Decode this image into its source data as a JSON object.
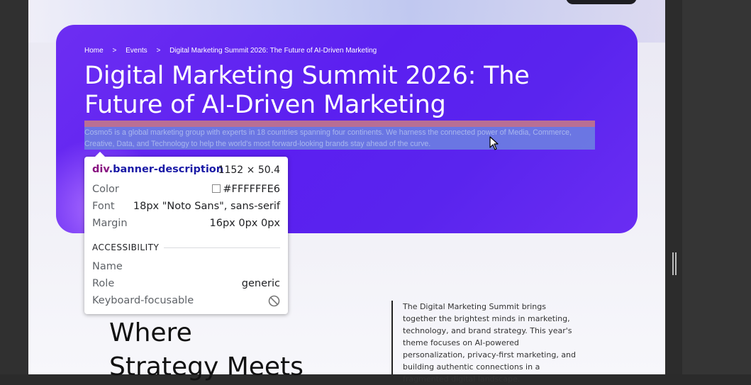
{
  "breadcrumb": {
    "home": "Home",
    "sep": ">",
    "events": "Events",
    "current": "Digital Marketing Summit 2026: The Future of AI-Driven Marketing"
  },
  "banner": {
    "title": "Digital Marketing Summit 2026: The Future of AI-Driven Marketing",
    "description": "Cosmo5 is a global marketing group with experts in 18 countries spanning four continents. We harness the connected power of Media, Commerce, Creative, Data, and Technology to help the world's most forward-looking brands stay ahead of the curve."
  },
  "inspector": {
    "tag": "div",
    "class_name": ".banner-description",
    "size": "1152 × 50.4",
    "color_label": "Color",
    "color_value": "#FFFFFFE6",
    "font_label": "Font",
    "font_value": "18px \"Noto Sans\", sans-serif",
    "margin_label": "Margin",
    "margin_value": "16px 0px 0px",
    "section_title": "ACCESSIBILITY",
    "name_label": "Name",
    "name_value": "",
    "role_label": "Role",
    "role_value": "generic",
    "focusable_label": "Keyboard-focusable"
  },
  "section": {
    "heading_line1": "Where",
    "heading_line2": "Strategy Meets",
    "intro": "The Digital Marketing Summit brings together the brightest minds in marketing, technology, and brand strategy. This year's theme focuses on AI-powered personalization, privacy-first marketing, and building authentic connections in a fragmented digital landscape."
  },
  "colors": {
    "banner": "#5b1ff0",
    "highlight_content": "#6d85e0",
    "highlight_margin": "#c97d84",
    "tag": "#881280",
    "class": "#1a1aa6"
  }
}
